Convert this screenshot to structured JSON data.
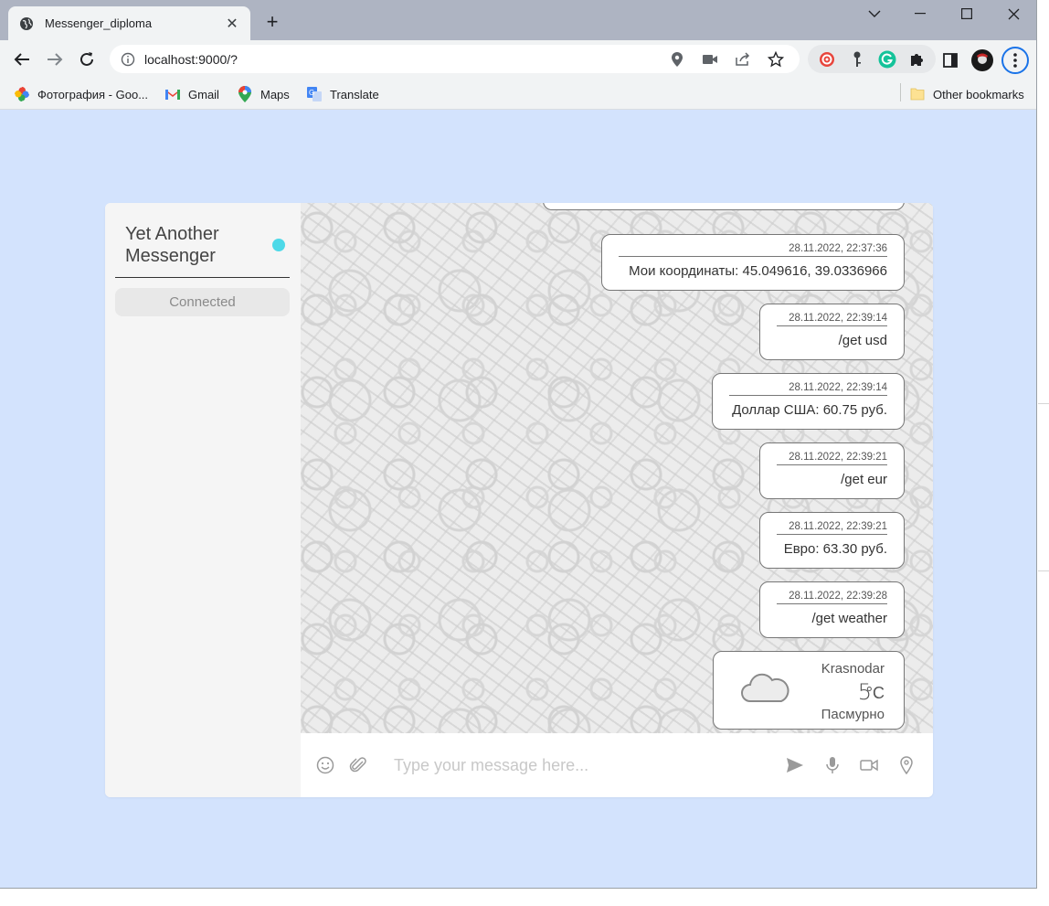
{
  "browser": {
    "tab_title": "Messenger_diploma",
    "url": "localhost:9000/?",
    "bookmarks": [
      {
        "label": "Фотография - Goo...",
        "icon": "photos-icon"
      },
      {
        "label": "Gmail",
        "icon": "gmail-icon"
      },
      {
        "label": "Maps",
        "icon": "maps-icon"
      },
      {
        "label": "Translate",
        "icon": "translate-icon"
      }
    ],
    "other_bookmarks": "Other bookmarks"
  },
  "app": {
    "title": "Yet Another Messenger",
    "status_color": "#4dd9e8",
    "connection_status": "Connected",
    "messages": [
      {
        "time": "28.11.2022, 22:37:36",
        "text": "Мои координаты: 45.049616, 39.0336966"
      },
      {
        "time": "28.11.2022, 22:39:14",
        "text": "/get usd"
      },
      {
        "time": "28.11.2022, 22:39:14",
        "text": "Доллар США: 60.75 руб."
      },
      {
        "time": "28.11.2022, 22:39:21",
        "text": "/get eur"
      },
      {
        "time": "28.11.2022, 22:39:21",
        "text": "Евро: 63.30 руб."
      },
      {
        "time": "28.11.2022, 22:39:28",
        "text": "/get weather"
      }
    ],
    "weather": {
      "city": "Krasnodar",
      "temperature": "5",
      "unit": "°C",
      "description": "Пасмурно",
      "icon": "cloud-icon"
    },
    "composer": {
      "placeholder": "Type your message here..."
    }
  }
}
